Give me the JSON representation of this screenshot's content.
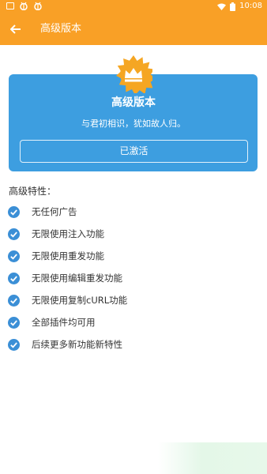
{
  "status_bar": {
    "time": "10:08",
    "left_icons": [
      "notification-square-icon",
      "bug-icon",
      "bug-icon"
    ],
    "right_icons": [
      "wifi-icon",
      "battery-icon"
    ]
  },
  "app_bar": {
    "title": "高级版本",
    "back_icon": "arrow-left-icon"
  },
  "premium_card": {
    "badge_icon": "crown-icon",
    "title": "高级版本",
    "subtitle": "与君初相识，犹如故人归。",
    "status_button_label": "已激活"
  },
  "features": {
    "heading": "高级特性：",
    "items": [
      {
        "label": "无任何广告"
      },
      {
        "label": "无限使用注入功能"
      },
      {
        "label": "无限使用重发功能"
      },
      {
        "label": "无限使用编辑重发功能"
      },
      {
        "label": "无限使用复制cURL功能"
      },
      {
        "label": "全部插件均可用"
      },
      {
        "label": "后续更多新功能新特性"
      }
    ]
  },
  "colors": {
    "accent_orange": "#f9a026",
    "card_blue": "#3d9ee0",
    "check_blue": "#3b8fd6",
    "badge_gold": "#f5a623"
  }
}
